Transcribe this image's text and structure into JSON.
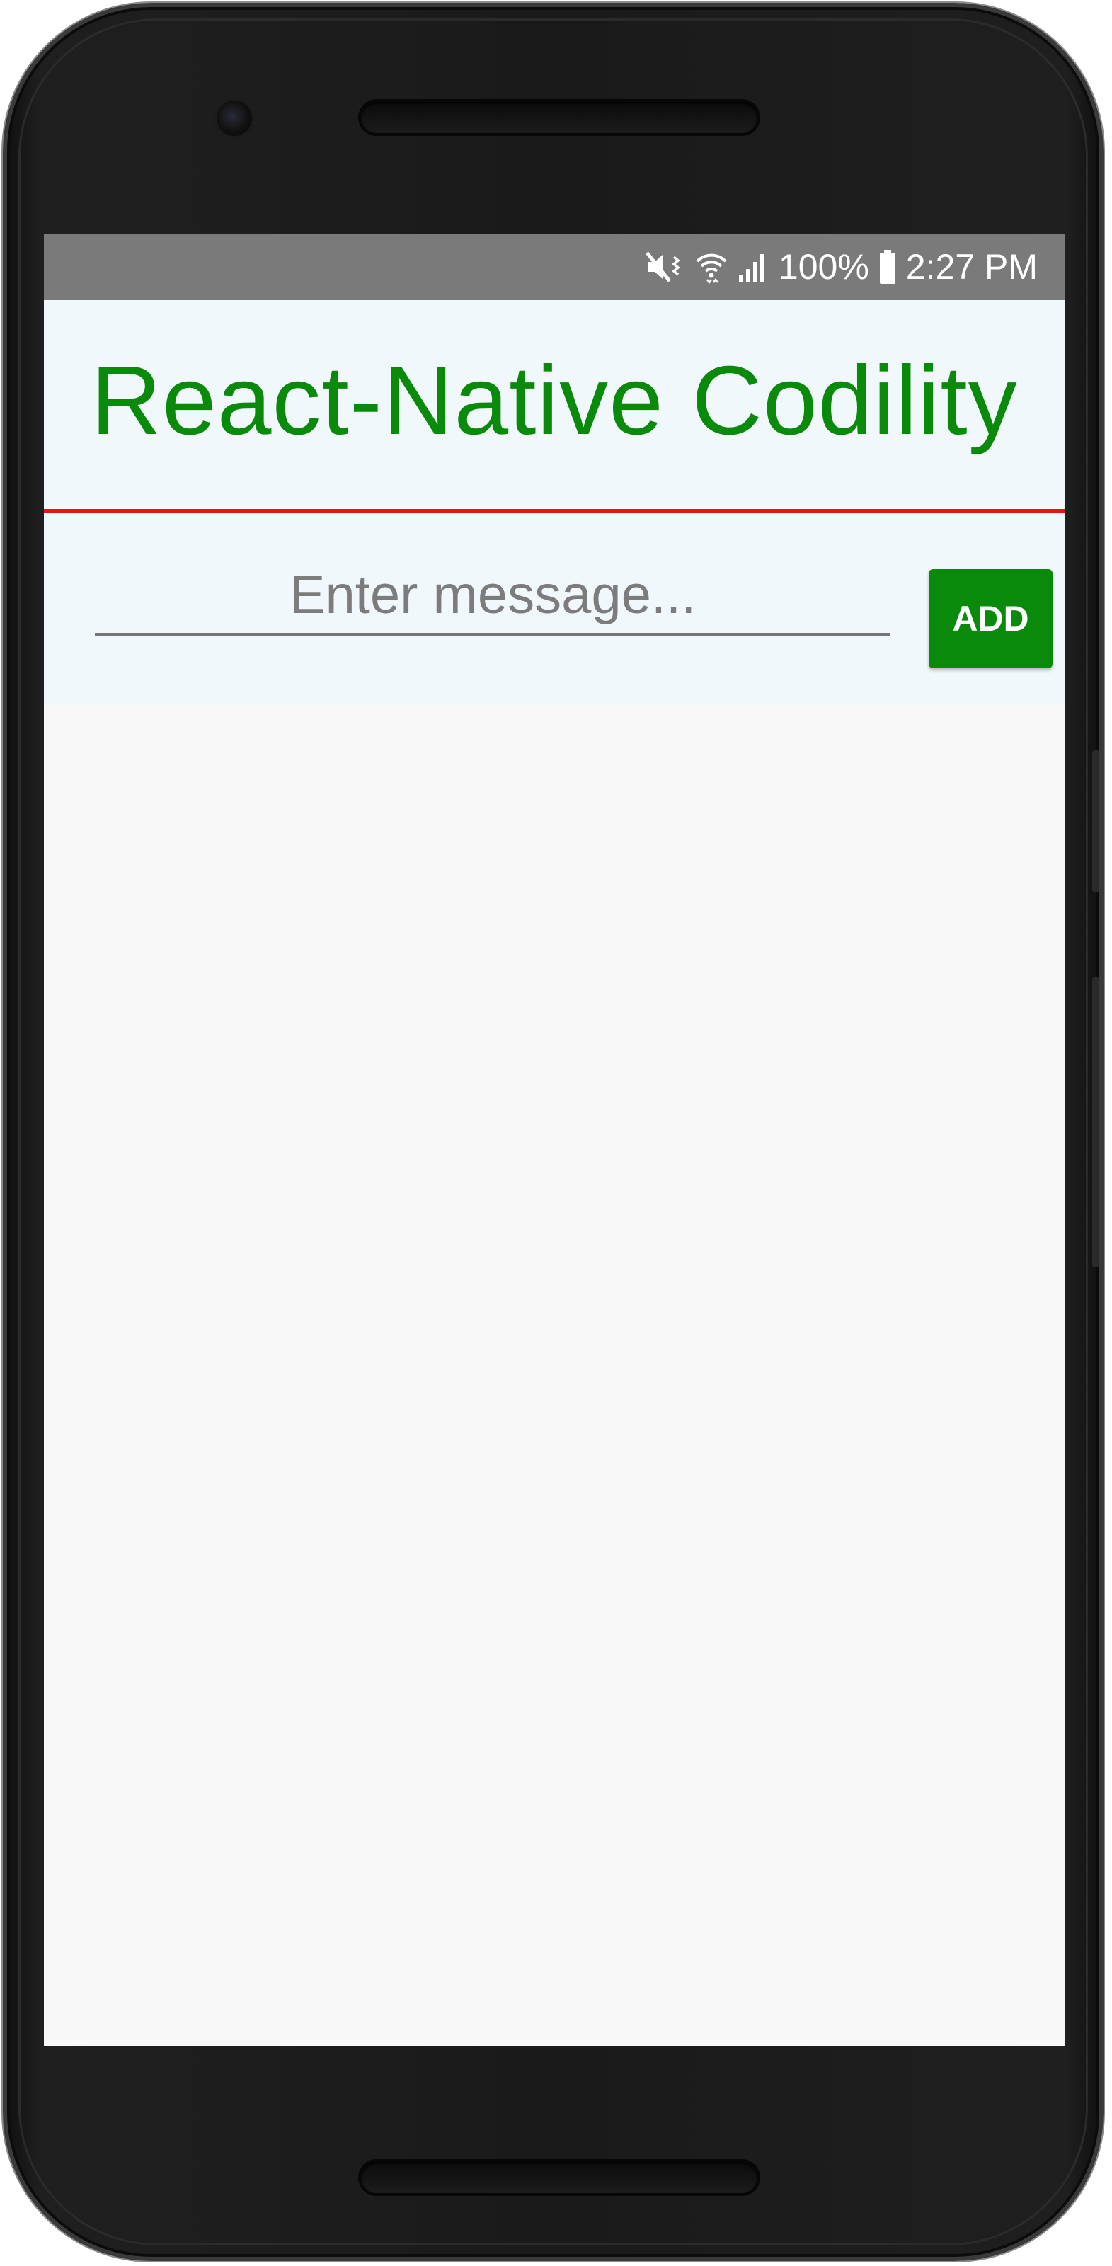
{
  "status_bar": {
    "battery_percent": "100%",
    "time": "2:27 PM",
    "icons": [
      "mute-vibrate-icon",
      "wifi-icon",
      "signal-icon",
      "battery-icon"
    ]
  },
  "header": {
    "title": "React-Native Codility"
  },
  "composer": {
    "input_placeholder": "Enter message...",
    "input_value": "",
    "add_label": "ADD"
  },
  "messages": [],
  "colors": {
    "title_green": "#0a8a0a",
    "button_green": "#0a8a0a",
    "divider_red": "#e0161b",
    "header_bg": "#f1f8fc",
    "status_bar_bg": "#7a7a7a"
  }
}
